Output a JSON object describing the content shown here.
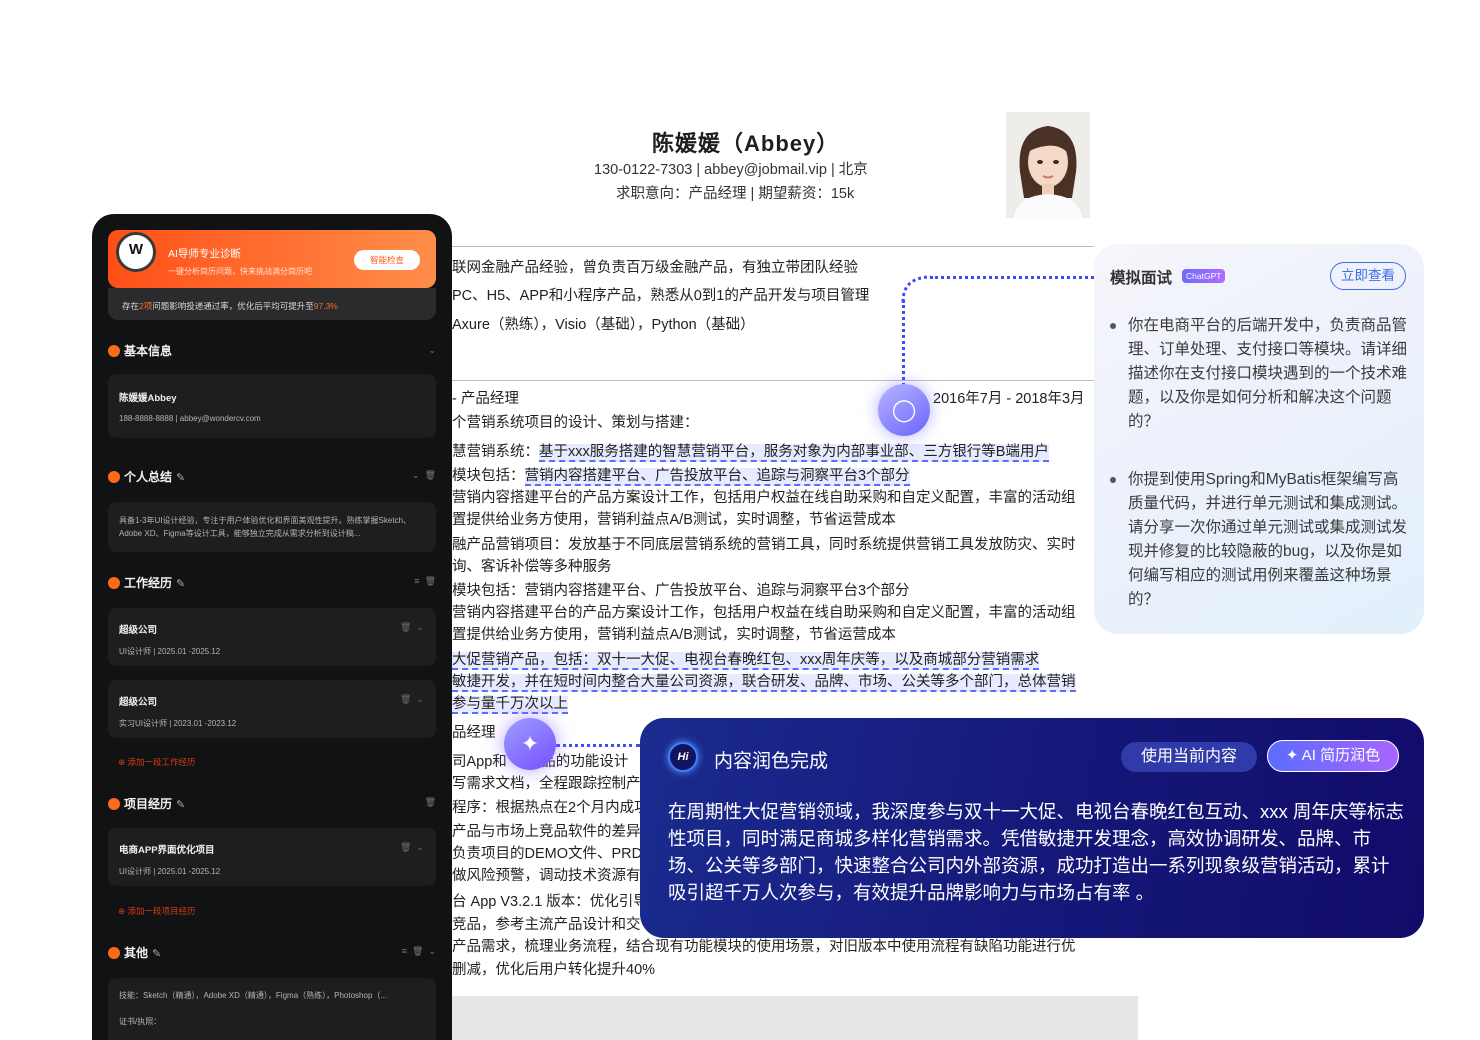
{
  "resume": {
    "name": "陈媛媛（Abbey）",
    "contact": "130-0122-7303 | abbey@jobmail.vip | 北京",
    "intent": "求职意向：产品经理 |  期望薪资：15k",
    "summary_lines": [
      "联网金融产品经验，曾负责百万级金融产品，有独立带团队经验",
      "PC、H5、APP和小程序产品，熟悉从0到1的产品开发与项目管理",
      "Axure（熟练），Visio（基础），Python（基础）"
    ],
    "job_title": "- 产品经理",
    "job_date": "2016年7月 - 2018年3月",
    "job_lines": [
      "个营销系统项目的设计、策划与搭建：",
      "慧营销系统：",
      "模块包括：",
      "营销内容搭建平台的产品方案设计工作，包括用户权益在线自助采购和自定义配置，丰富的活动组",
      "置提供给业务方使用，营销利益点A/B测试，实时调整，节省运营成本",
      "融产品营销项目：发放基于不同底层营销系统的营销工具，同时系统提供营销工具发放防灾、实时",
      "询、客诉补偿等多种服务",
      "模块包括：营销内容搭建平台、广告投放平台、追踪与洞察平台3个部分",
      "营销内容搭建平台的产品方案设计工作，包括用户权益在线自助采购和自定义配置，丰富的活动组",
      "置提供给业务方使用，营销利益点A/B测试，实时调整，节省运营成本"
    ],
    "hl_1": "基于xxx服务搭建的智慧营销平台，服务对象为内部事业部、三方银行等B端用户",
    "hl_2": "营销内容搭建平台、广告投放平台、追踪与洞察平台3个部分",
    "hl_lines": [
      "大促营销产品，包括：双十一大促、电视台春晚红包、xxx周年庆等，以及商城部分营销需求",
      "敏捷开发，并在短时间内整合大量公司资源，联合研发、品牌、市场、公关等多个部门，总体营销",
      "参与量千万次以上"
    ],
    "job2_title": "品经理",
    "job2_lines": [
      "司App和",
      "写需求文档，全程跟踪控制产",
      "程序：根据热点在2个月内成功",
      "产品与市场上竞品软件的差异",
      "负责项目的DEMO文件、PRD",
      "做风险预警，调动技术资源有",
      "台 App V3.2.1 版本：优化引导",
      "竞品，参考主流产品设计和交"
    ],
    "job2_tail1": "产品的功能设计",
    "job2_tail2": "产品需求，梳理业务流程，结合现有功能模块的使用场景，对旧版本中使用流程有缺陷功能进行优",
    "job2_tail3": "删减，优化后用户转化提升40%"
  },
  "panel": {
    "ai_title": "AI导师专业诊断",
    "ai_desc": "一键分析简历问题，快来挑战满分简历吧",
    "ai_check": "智能检查",
    "ai_note_a": "存在",
    "ai_note_n": "2项",
    "ai_note_b": "问题影响投递通过率，优化后平均可提升至",
    "ai_note_pct": "97.3%",
    "sections": {
      "basic": "基本信息",
      "summary": "个人总结",
      "work": "工作经历",
      "project": "项目经历",
      "other": "其他"
    },
    "basic_name": "陈媛媛Abbey",
    "basic_contact": "188-8888-8888 | abbey@wondercv.com",
    "summary_text": "具备1-3年UI设计经验，专注于用户体验优化和界面美观性提升。熟练掌握Sketch、Adobe XD、Figma等设计工具，能够独立完成从需求分析到设计稿...",
    "works": [
      {
        "company": "超级公司",
        "detail": "UI设计师 | 2025.01 -2025.12"
      },
      {
        "company": "超级公司",
        "detail": "实习UI设计师 | 2023.01 -2023.12"
      }
    ],
    "add_work": "添加一段工作经历",
    "project": {
      "name": "电商APP界面优化项目",
      "detail": "UI设计师 | 2025.01 -2025.12"
    },
    "add_project": "添加一段项目经历",
    "other_skills": "技能：Sketch（精通），Adobe XD（精通），Figma（熟练），Photoshop（...",
    "other_cert": "证书/执照："
  },
  "interview": {
    "title": "模拟面试",
    "tag": "ChatGPT",
    "button": "立即查看",
    "questions": [
      "你在电商平台的后端开发中，负责商品管理、订单处理、支付接口等模块。请详细描述你在支付接口模块遇到的一个技术难题，以及你是如何分析和解决这个问题的？",
      "你提到使用Spring和MyBatis框架编写高质量代码，并进行单元测试和集成测试。请分享一次你通过单元测试或集成测试发现并修复的比较隐蔽的bug，以及你是如何编写相应的测试用例来覆盖这种场景的？"
    ]
  },
  "polish": {
    "hi": "Hi",
    "title": "内容润色完成",
    "use_button": "使用当前内容",
    "ai_button": "AI 简历润色",
    "text": "在周期性大促营销领域，我深度参与双十一大促、电视台春晚红包互动、xxx 周年庆等标志性项目，同时满足商城多样化营销需求。凭借敏捷开发理念，高效协调研发、品牌、市场、公关等多部门，快速整合公司内外部资源，成功打造出一系列现象级营销活动，累计吸引超千万人次参与，有效提升品牌影响力与市场占有率 。"
  },
  "colors": {
    "accent": "#3b4cff",
    "orange": "#ff6a1a",
    "panel_bg": "#101213"
  },
  "icons": [
    "chevron-down-icon",
    "edit-pen-icon",
    "trash-icon",
    "sort-icon",
    "plus-circle-icon",
    "sparkle-icon",
    "chat-bubble-icon"
  ]
}
